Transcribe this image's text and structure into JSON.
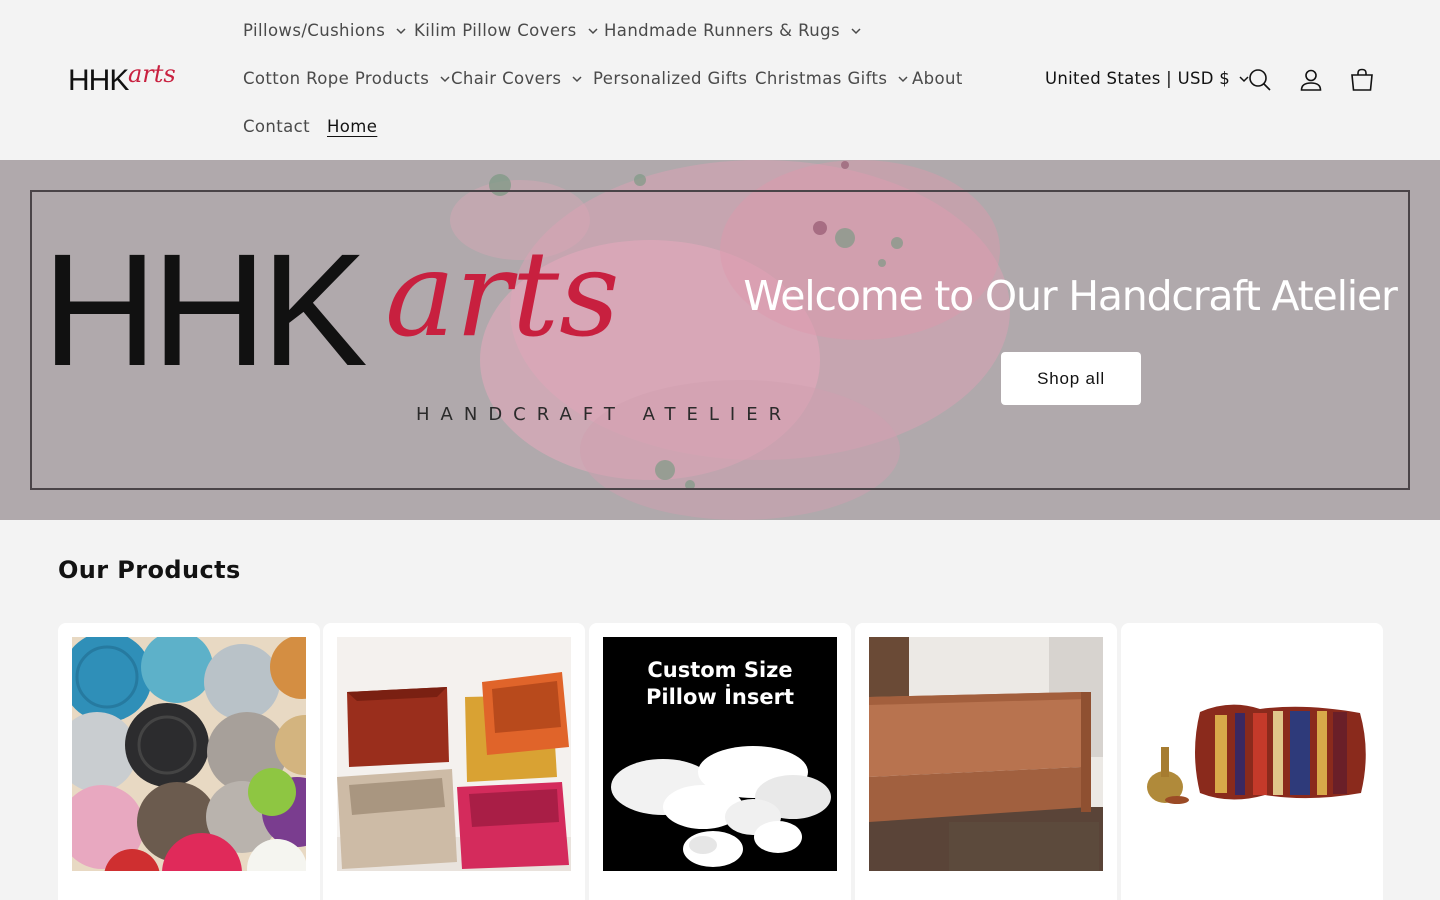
{
  "header": {
    "logo_alt": "HHKarts",
    "logo_text_dark": "HHK",
    "logo_text_script": "arts",
    "nav": [
      {
        "label": "Pillows/Cushions",
        "has_dropdown": true
      },
      {
        "label": "Kilim Pillow Covers",
        "has_dropdown": true
      },
      {
        "label": "Handmade Runners & Rugs",
        "has_dropdown": true
      },
      {
        "label": "Cotton Rope Products",
        "has_dropdown": true
      },
      {
        "label": "Chair Covers",
        "has_dropdown": true
      },
      {
        "label": "Personalized Gifts",
        "has_dropdown": false
      },
      {
        "label": "Christmas Gifts",
        "has_dropdown": true
      },
      {
        "label": "About",
        "has_dropdown": false
      },
      {
        "label": "Contact",
        "has_dropdown": false
      },
      {
        "label": "Home",
        "has_dropdown": false,
        "active": true
      }
    ],
    "country_selector": "United States | USD $",
    "icons": [
      "search-icon",
      "account-icon",
      "cart-icon"
    ]
  },
  "banner": {
    "logo_text_dark": "HHK",
    "logo_text_script": "arts",
    "tagline": "HANDCRAFT ATELIER",
    "heading": "Welcome to Our Handcraft Atelier",
    "button_label": "Shop all",
    "background_color": "#b0a9ac",
    "accent_color": "#e2a0b6"
  },
  "products": {
    "title": "Our Products",
    "items": [
      {
        "image": "colorful cotton rope coasters"
      },
      {
        "image": "rope storage baskets"
      },
      {
        "image": "pillow inserts",
        "image_text_line1": "Custom Size",
        "image_text_line2": "Pillow İnsert"
      },
      {
        "image": "brown cushion"
      },
      {
        "image": "kilim lumbar pillow"
      }
    ]
  },
  "colors": {
    "page_bg": "#f3f3f3",
    "text": "#121212",
    "nav_text": "#4a4a4a",
    "logo_red": "#c8203f"
  }
}
